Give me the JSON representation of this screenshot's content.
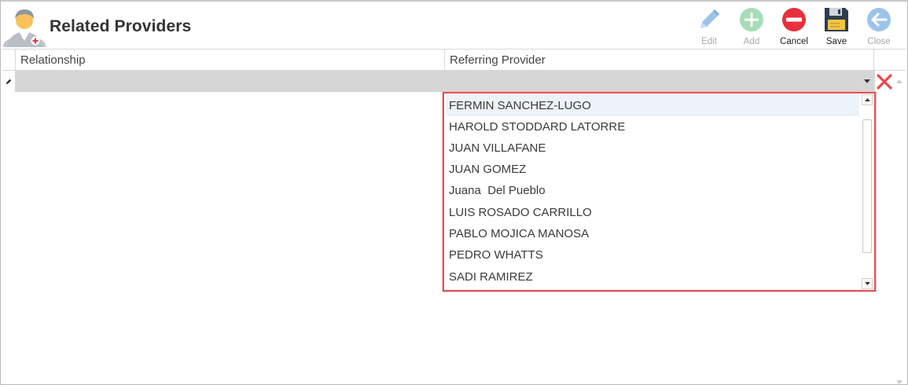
{
  "header": {
    "title": "Related Providers"
  },
  "toolbar": {
    "edit_label": "Edit",
    "add_label": "Add",
    "cancel_label": "Cancel",
    "save_label": "Save",
    "close_label": "Close"
  },
  "grid": {
    "columns": [
      "Relationship",
      "Referring Provider"
    ]
  },
  "dropdown": {
    "items": [
      "FERMIN SANCHEZ-LUGO",
      "HAROLD STODDARD LATORRE",
      "JUAN VILLAFANE",
      "JUAN GOMEZ",
      "Juana  Del Pueblo",
      "LUIS ROSADO CARRILLO",
      "PABLO MOJICA MANOSA",
      "PEDRO WHATTS",
      "SADI RAMIREZ"
    ],
    "selected_index": 0
  },
  "colors": {
    "accent_red": "#e05357",
    "disabled_blue": "#9cc4ea",
    "disabled_green": "#a6dcb6",
    "cancel_red": "#e8303b"
  },
  "icons": {
    "app": "provider-avatar-icon",
    "edit": "pencil-icon",
    "add": "plus-circle-icon",
    "cancel": "minus-circle-icon",
    "save": "floppy-disk-icon",
    "close": "arrow-left-circle-icon",
    "row_edit": "pencil-small-icon",
    "row_delete": "x-icon"
  }
}
